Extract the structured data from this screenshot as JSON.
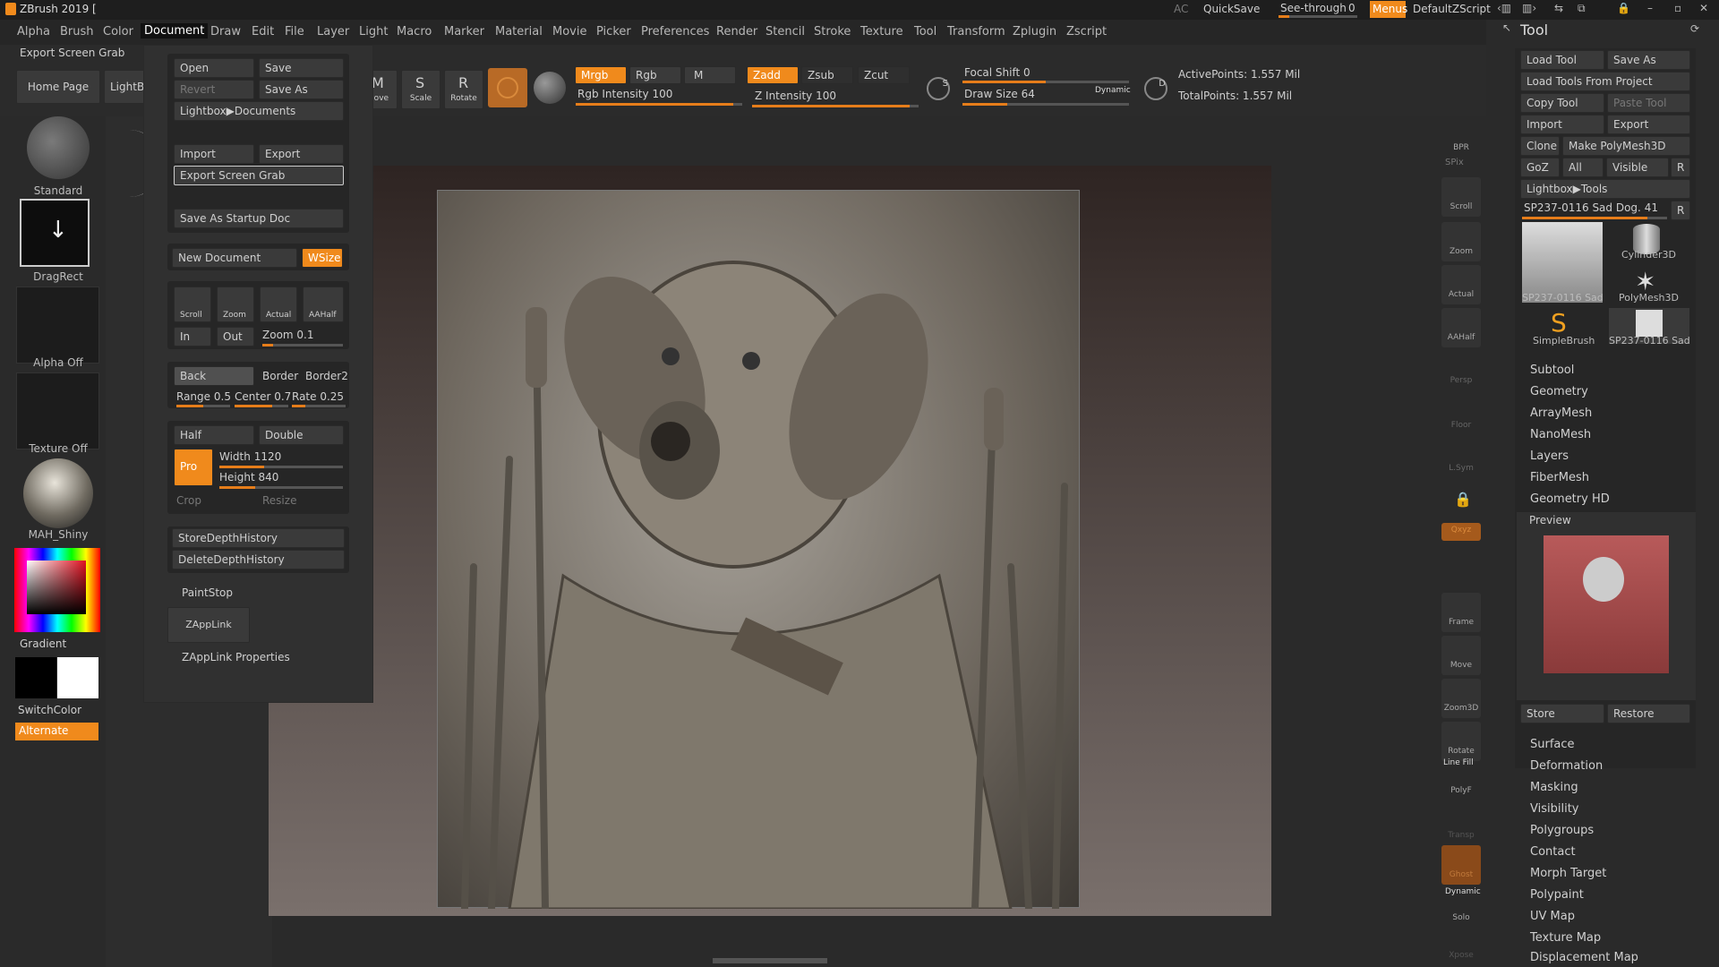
{
  "titlebar": {
    "app_title": "ZBrush 2019 [",
    "ac": "AC",
    "quicksave": "QuickSave",
    "see_through_label": "See-through",
    "see_through_value": "0",
    "menus": "Menus",
    "default_zscript": "DefaultZScript"
  },
  "menubar": {
    "items": [
      "Alpha",
      "Brush",
      "Color",
      "Document",
      "Draw",
      "Edit",
      "File",
      "Layer",
      "Light",
      "Macro",
      "Marker",
      "Material",
      "Movie",
      "Picker",
      "Preferences",
      "Render",
      "Stencil",
      "Stroke",
      "Texture",
      "Tool",
      "Transform",
      "Zplugin",
      "Zscript"
    ],
    "active": "Document"
  },
  "toprow": {
    "export_screen_grab": "Export Screen Grab",
    "home_page": "Home Page",
    "lightbox": "LightBox",
    "move": "Move",
    "scale": "Scale",
    "rotate": "Rotate",
    "mrgb": "Mrgb",
    "rgb": "Rgb",
    "m": "M",
    "zadd": "Zadd",
    "zsub": "Zsub",
    "zcut": "Zcut",
    "rgb_intensity_label": "Rgb Intensity",
    "rgb_intensity_value": "100",
    "z_intensity_label": "Z Intensity",
    "z_intensity_value": "100",
    "focal_shift_label": "Focal Shift",
    "focal_shift_value": "0",
    "draw_size_label": "Draw Size",
    "draw_size_value": "64",
    "dynamic": "Dynamic",
    "active_points": "ActivePoints: 1.557 Mil",
    "total_points": "TotalPoints: 1.557 Mil"
  },
  "leftshelf": {
    "brush": "Standard",
    "stroke": "DragRect",
    "alpha": "Alpha Off",
    "texture": "Texture Off",
    "material": "MAH_Shiny",
    "gradient": "Gradient",
    "switchcolor": "SwitchColor",
    "alternate": "Alternate"
  },
  "document_menu": {
    "open": "Open",
    "save": "Save",
    "revert": "Revert",
    "save_as": "Save As",
    "lightbox_documents": "Lightbox▶Documents",
    "import": "Import",
    "export": "Export",
    "export_screen_grab": "Export Screen Grab",
    "save_as_startup_doc": "Save As Startup Doc",
    "new_document": "New Document",
    "wsize": "WSize",
    "scroll": "Scroll",
    "zoom": "Zoom",
    "actual": "Actual",
    "aahalf": "AAHalf",
    "in": "In",
    "out": "Out",
    "zoom_label": "Zoom",
    "zoom_value": "0.1",
    "back": "Back",
    "border": "Border",
    "border2": "Border2",
    "range_label": "Range",
    "range_value": "0.5",
    "center_label": "Center",
    "center_value": "0.7",
    "rate_label": "Rate",
    "rate_value": "0.25",
    "half": "Half",
    "double": "Double",
    "pro": "Pro",
    "width_label": "Width",
    "width_value": "1120",
    "height_label": "Height",
    "height_value": "840",
    "crop": "Crop",
    "resize": "Resize",
    "store_depth_history": "StoreDepthHistory",
    "delete_depth_history": "DeleteDepthHistory",
    "paintstop": "PaintStop",
    "zapplink": "ZAppLink",
    "zapplink_properties": "ZAppLink Properties"
  },
  "rightshelf": {
    "bpr": "BPR",
    "spix": "SPix",
    "buttons": [
      "Scroll",
      "Zoom",
      "Actual",
      "AAHalf",
      "Persp",
      "Floor",
      "L.Sym",
      "",
      "Qxyz",
      "",
      "",
      "Frame",
      "Move",
      "Zoom3D",
      "Rotate",
      "PolyF",
      "Transp",
      "Ghost",
      "Solo",
      "Xpose"
    ],
    "line_fill": "Line Fill",
    "dynamic": "Dynamic"
  },
  "toolpanel": {
    "title": "Tool",
    "load_tool": "Load Tool",
    "save_as": "Save As",
    "load_tools_from_project": "Load Tools From Project",
    "copy_tool": "Copy Tool",
    "paste_tool": "Paste Tool",
    "import": "Import",
    "export": "Export",
    "clone": "Clone",
    "make_polymesh3d": "Make PolyMesh3D",
    "goz": "GoZ",
    "all": "All",
    "visible": "Visible",
    "r": "R",
    "lightbox_tools": "Lightbox▶Tools",
    "current_tool_label": "SP237-0116 Sad Dog.",
    "current_tool_value": "41",
    "tools": [
      "SP237-0116 Sad",
      "Cylinder3D",
      "PolyMesh3D",
      "SimpleBrush",
      "SP237-0116 Sad"
    ],
    "subpalettes_a": [
      "Subtool",
      "Geometry",
      "ArrayMesh",
      "NanoMesh",
      "Layers",
      "FiberMesh",
      "Geometry HD",
      "Preview"
    ],
    "store": "Store",
    "restore": "Restore",
    "subpalettes_b": [
      "Surface",
      "Deformation",
      "Masking",
      "Visibility",
      "Polygroups",
      "Contact",
      "Morph Target",
      "Polypaint",
      "UV Map",
      "Texture Map",
      "Displacement Map"
    ]
  },
  "colors": {
    "accent": "#f08a1c",
    "panel": "#2a2a2a"
  }
}
